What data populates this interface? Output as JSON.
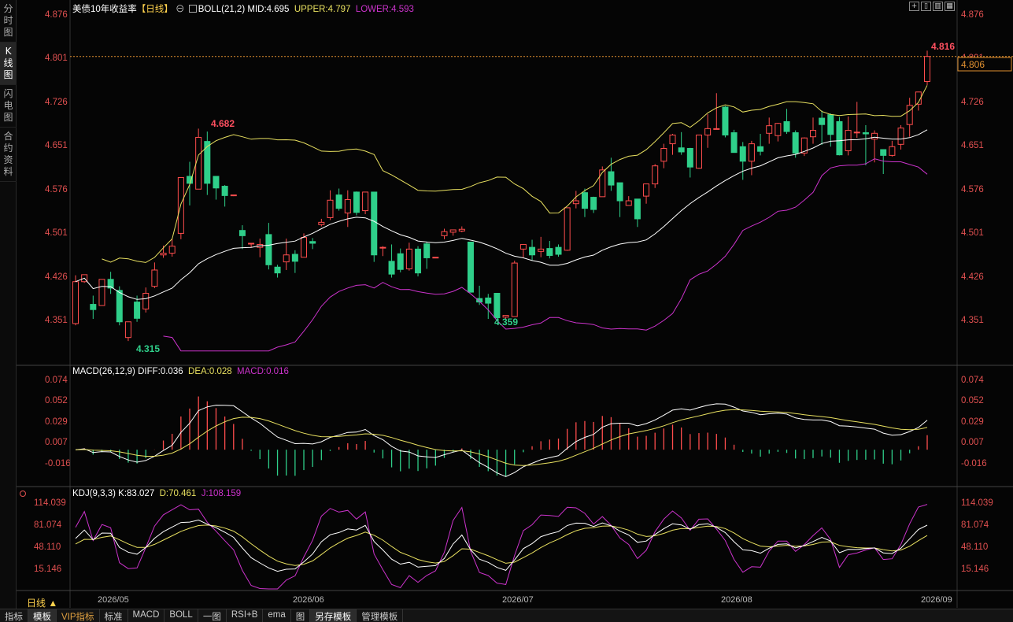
{
  "side_tabs": [
    {
      "label": "分时图",
      "active": false
    },
    {
      "label": "K线图",
      "active": true
    },
    {
      "label": "闪电图",
      "active": false
    },
    {
      "label": "合约资料",
      "active": false
    }
  ],
  "main_header": {
    "title": "美债10年收益率",
    "period": "【日线】",
    "indicator": "BOLL(21,2)",
    "mid": "MID:4.695",
    "upper": "UPPER:4.797",
    "lower": "LOWER:4.593"
  },
  "price_axis": [
    "4.876",
    "4.801",
    "4.726",
    "4.651",
    "4.576",
    "4.501",
    "4.426",
    "4.351"
  ],
  "price_annotations": {
    "high": "4.816",
    "current": "4.806",
    "peak": "4.682",
    "low1": "4.315",
    "low2": "4.359"
  },
  "macd_header": {
    "name": "MACD(26,12,9)",
    "diff": "DIFF:0.036",
    "dea": "DEA:0.028",
    "macd": "MACD:0.016"
  },
  "macd_axis": [
    "0.074",
    "0.052",
    "0.029",
    "0.007",
    "-0.016"
  ],
  "kdj_header": {
    "name": "KDJ(9,3,3)",
    "k": "K:83.027",
    "d": "D:70.461",
    "j": "J:108.159"
  },
  "kdj_axis": [
    "114.039",
    "81.074",
    "48.110",
    "15.146"
  ],
  "period_label": "日线 ▲",
  "dates": [
    "2026/05",
    "2026/06",
    "2026/07",
    "2026/08",
    "2026/09"
  ],
  "bottom_tabs": [
    {
      "label": "指标",
      "style": ""
    },
    {
      "label": "模板",
      "style": "hl"
    },
    {
      "label": "VIP指标",
      "style": "vip"
    },
    {
      "label": "标准",
      "style": ""
    },
    {
      "label": "MACD",
      "style": ""
    },
    {
      "label": "BOLL",
      "style": ""
    },
    {
      "label": "一图",
      "style": ""
    },
    {
      "label": "RSI+B",
      "style": ""
    },
    {
      "label": "ema",
      "style": ""
    },
    {
      "label": "图",
      "style": ""
    },
    {
      "label": "另存模板",
      "style": "hl"
    },
    {
      "label": "管理模板",
      "style": ""
    }
  ],
  "colors": {
    "up": "#ff4d4d",
    "down": "#2fcf8a",
    "upper": "#e8e060",
    "mid": "#ffffff",
    "lower": "#cc33cc"
  },
  "chart_data": {
    "type": "candlestick",
    "price_range": [
      4.3,
      4.88
    ],
    "candles": [
      [
        4.347,
        4.419,
        4.344,
        4.43
      ],
      [
        4.419,
        4.431,
        4.417,
        4.431
      ],
      [
        4.38,
        4.371,
        4.355,
        4.395
      ],
      [
        4.378,
        4.423,
        4.378,
        4.423
      ],
      [
        4.423,
        4.408,
        4.398,
        4.436
      ],
      [
        4.404,
        4.35,
        4.344,
        4.411
      ],
      [
        4.323,
        4.35,
        4.317,
        4.35
      ],
      [
        4.384,
        4.356,
        4.35,
        4.395
      ],
      [
        4.372,
        4.399,
        4.366,
        4.409
      ],
      [
        4.411,
        4.439,
        4.408,
        4.452
      ],
      [
        4.465,
        4.468,
        4.46,
        4.481
      ],
      [
        4.468,
        4.48,
        4.462,
        4.492
      ],
      [
        4.502,
        4.598,
        4.492,
        4.598
      ],
      [
        4.6,
        4.588,
        4.55,
        4.625
      ],
      [
        4.578,
        4.667,
        4.578,
        4.682
      ],
      [
        4.66,
        4.588,
        4.568,
        4.677
      ],
      [
        4.6,
        4.58,
        4.56,
        4.6
      ],
      [
        4.583,
        4.567,
        4.548,
        4.585
      ],
      [
        4.568,
        4.568,
        4.566,
        4.568
      ],
      [
        4.507,
        4.498,
        4.475,
        4.516
      ],
      [
        4.485,
        4.485,
        4.478,
        4.485
      ],
      [
        4.478,
        4.483,
        4.461,
        4.493
      ],
      [
        4.5,
        4.448,
        4.44,
        4.52
      ],
      [
        4.444,
        4.434,
        4.426,
        4.448
      ],
      [
        4.453,
        4.465,
        4.439,
        4.493
      ],
      [
        4.466,
        4.454,
        4.434,
        4.473
      ],
      [
        4.461,
        4.495,
        4.461,
        4.502
      ],
      [
        4.488,
        4.485,
        4.475,
        4.494
      ],
      [
        4.517,
        4.521,
        4.514,
        4.527
      ],
      [
        4.529,
        4.559,
        4.525,
        4.576
      ],
      [
        4.568,
        4.545,
        4.541,
        4.579
      ],
      [
        4.537,
        4.56,
        4.513,
        4.576
      ],
      [
        4.573,
        4.538,
        4.533,
        4.574
      ],
      [
        4.541,
        4.573,
        4.535,
        4.573
      ],
      [
        4.573,
        4.465,
        4.453,
        4.573
      ],
      [
        4.477,
        4.478,
        4.463,
        4.48
      ],
      [
        4.454,
        4.432,
        4.426,
        4.483
      ],
      [
        4.467,
        4.44,
        4.435,
        4.476
      ],
      [
        4.441,
        4.475,
        4.438,
        4.486
      ],
      [
        4.475,
        4.434,
        4.428,
        4.48
      ],
      [
        4.484,
        4.46,
        4.441,
        4.488
      ],
      [
        4.461,
        4.461,
        4.461,
        4.461
      ],
      [
        4.498,
        4.505,
        4.492,
        4.51
      ],
      [
        4.504,
        4.508,
        4.498,
        4.508
      ],
      [
        4.506,
        4.509,
        4.504,
        4.514
      ],
      [
        4.487,
        4.401,
        4.4,
        4.487
      ],
      [
        4.39,
        4.384,
        4.379,
        4.412
      ],
      [
        4.391,
        4.382,
        4.355,
        4.398
      ],
      [
        4.399,
        4.357,
        4.351,
        4.399
      ],
      [
        4.358,
        4.361,
        4.353,
        4.361
      ],
      [
        4.359,
        4.451,
        4.359,
        4.455
      ],
      [
        4.475,
        4.483,
        4.461,
        4.479
      ],
      [
        4.478,
        4.465,
        4.456,
        4.491
      ],
      [
        4.471,
        4.475,
        4.461,
        4.496
      ],
      [
        4.476,
        4.464,
        4.459,
        4.489
      ],
      [
        4.478,
        4.466,
        4.462,
        4.483
      ],
      [
        4.473,
        4.546,
        4.472,
        4.546
      ],
      [
        4.553,
        4.558,
        4.545,
        4.575
      ],
      [
        4.572,
        4.545,
        4.53,
        4.579
      ],
      [
        4.564,
        4.543,
        4.537,
        4.565
      ],
      [
        4.565,
        4.611,
        4.565,
        4.617
      ],
      [
        4.608,
        4.585,
        4.575,
        4.632
      ],
      [
        4.589,
        4.558,
        4.53,
        4.589
      ],
      [
        4.55,
        4.558,
        4.55,
        4.566
      ],
      [
        4.561,
        4.527,
        4.513,
        4.561
      ],
      [
        4.566,
        4.587,
        4.553,
        4.587
      ],
      [
        4.587,
        4.618,
        4.58,
        4.621
      ],
      [
        4.626,
        4.648,
        4.614,
        4.656
      ],
      [
        4.656,
        4.671,
        4.637,
        4.673
      ],
      [
        4.649,
        4.642,
        4.637,
        4.676
      ],
      [
        4.648,
        4.616,
        4.598,
        4.649
      ],
      [
        4.614,
        4.671,
        4.613,
        4.671
      ],
      [
        4.671,
        4.682,
        4.649,
        4.707
      ],
      [
        4.682,
        4.682,
        4.682,
        4.743
      ],
      [
        4.719,
        4.671,
        4.667,
        4.721
      ],
      [
        4.675,
        4.641,
        4.642,
        4.68
      ],
      [
        4.651,
        4.626,
        4.594,
        4.659
      ],
      [
        4.626,
        4.656,
        4.602,
        4.661
      ],
      [
        4.651,
        4.643,
        4.636,
        4.673
      ],
      [
        4.674,
        4.687,
        4.656,
        4.701
      ],
      [
        4.67,
        4.691,
        4.66,
        4.692
      ],
      [
        4.694,
        4.677,
        4.673,
        4.716
      ],
      [
        4.675,
        4.64,
        4.632,
        4.679
      ],
      [
        4.64,
        4.666,
        4.635,
        4.667
      ],
      [
        4.668,
        4.679,
        4.656,
        4.701
      ],
      [
        4.7,
        4.689,
        4.654,
        4.713
      ],
      [
        4.706,
        4.672,
        4.651,
        4.708
      ],
      [
        4.694,
        4.637,
        4.636,
        4.702
      ],
      [
        4.644,
        4.679,
        4.636,
        4.703
      ],
      [
        4.676,
        4.676,
        4.666,
        4.728
      ],
      [
        4.675,
        4.673,
        4.619,
        4.688
      ],
      [
        4.664,
        4.674,
        4.624,
        4.679
      ],
      [
        4.646,
        4.636,
        4.604,
        4.64
      ],
      [
        4.636,
        4.651,
        4.634,
        4.661
      ],
      [
        4.655,
        4.683,
        4.646,
        4.688
      ],
      [
        4.689,
        4.722,
        4.668,
        4.735
      ],
      [
        4.724,
        4.745,
        4.713,
        4.74
      ],
      [
        4.763,
        4.806,
        4.757,
        4.816
      ]
    ]
  }
}
